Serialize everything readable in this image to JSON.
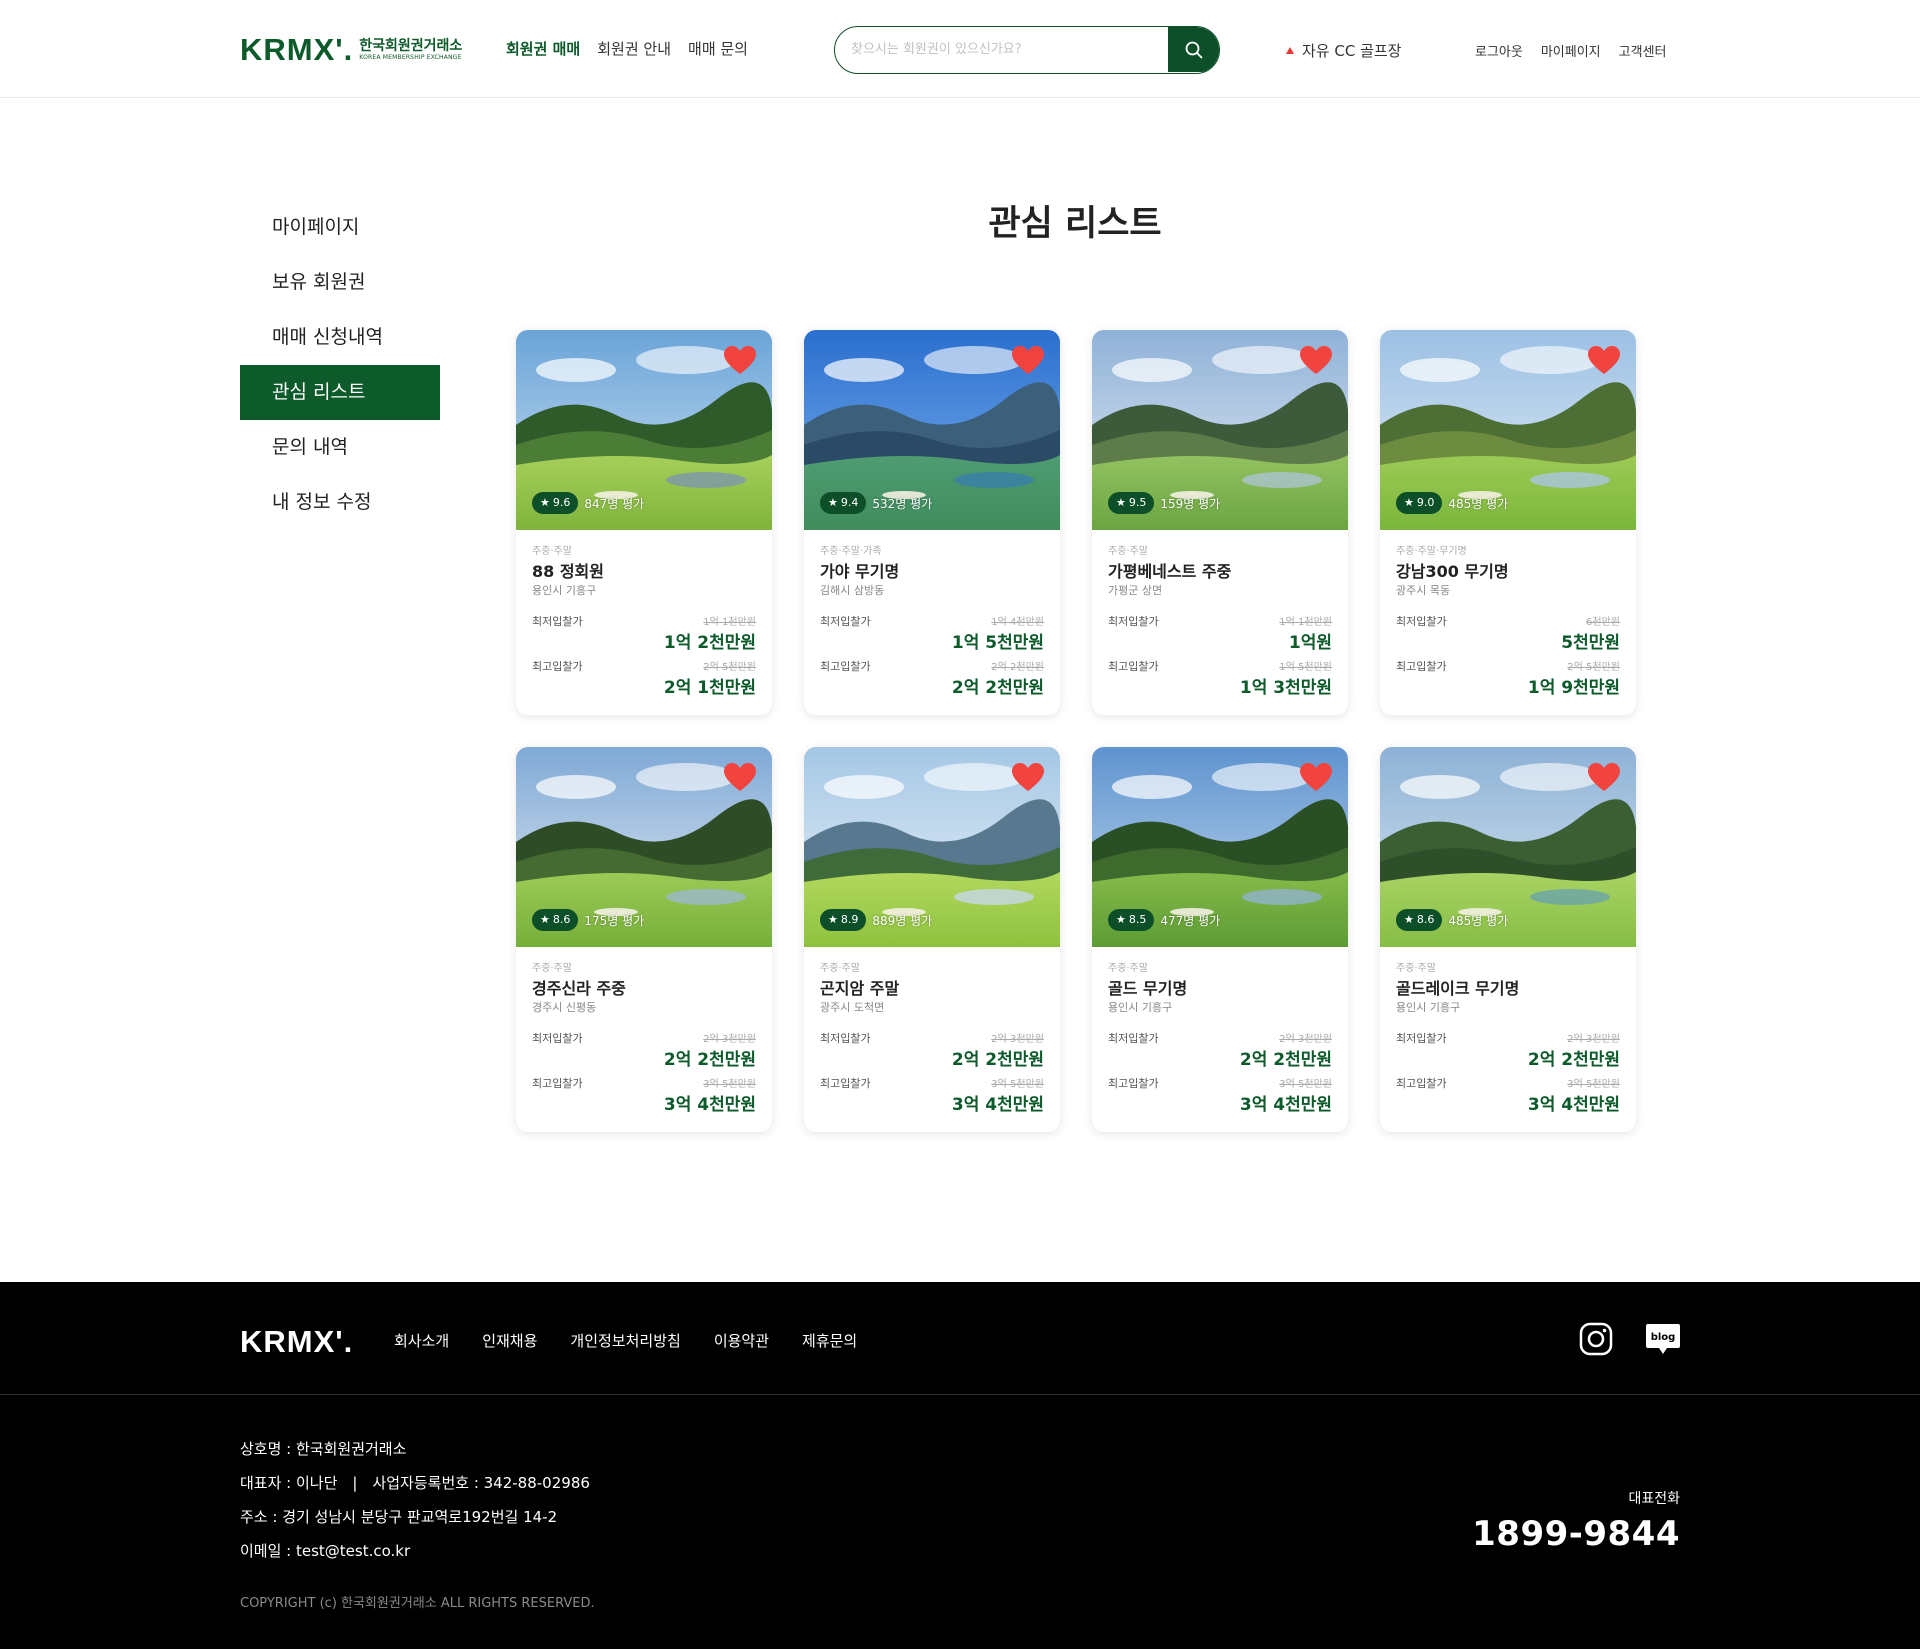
{
  "header": {
    "logo_mark": "KRMX'.",
    "logo_ko": "한국회원권거래소",
    "logo_en": "KOREA MEMBERSHIP EXCHANGE",
    "nav": [
      {
        "label": "회원권 매매",
        "active": true
      },
      {
        "label": "회원권 안내",
        "active": false
      },
      {
        "label": "매매 문의",
        "active": false
      }
    ],
    "search_placeholder": "찾으시는 회원권이 있으신가요?",
    "search_icon": "search-icon",
    "ticker": {
      "label": "자유 CC 골프장",
      "trend": "up",
      "trend_color": "#e53935"
    },
    "util_links": [
      "로그아웃",
      "마이페이지",
      "고객센터"
    ]
  },
  "sidebar": {
    "items": [
      {
        "label": "마이페이지",
        "active": false
      },
      {
        "label": "보유 회원권",
        "active": false
      },
      {
        "label": "매매 신청내역",
        "active": false
      },
      {
        "label": "관심 리스트",
        "active": true
      },
      {
        "label": "문의 내역",
        "active": false
      },
      {
        "label": "내 정보 수정",
        "active": false
      }
    ]
  },
  "main": {
    "title": "관심 리스트",
    "min_label": "최저입찰가",
    "max_label": "최고입찰가",
    "cards": [
      {
        "category": "주중·주말",
        "name": "88 정회원",
        "location": "용인시 기흥구",
        "rating": "9.6",
        "reviews": "847명 평가",
        "min_old": "1억 1천만원",
        "min_new": "1억 2천만원",
        "max_old": "2억 5천만원",
        "max_new": "2억 1천만원",
        "favorite": true
      },
      {
        "category": "주중·주말·가족",
        "name": "가야 무기명",
        "location": "김해시 삼방동",
        "rating": "9.4",
        "reviews": "532명 평가",
        "min_old": "1억 4천만원",
        "min_new": "1억 5천만원",
        "max_old": "2억 2천만원",
        "max_new": "2억 2천만원",
        "favorite": true
      },
      {
        "category": "주중·주말",
        "name": "가평베네스트 주중",
        "location": "가평군 상면",
        "rating": "9.5",
        "reviews": "159명 평가",
        "min_old": "1억 1천만원",
        "min_new": "1억원",
        "max_old": "1억 5천만원",
        "max_new": "1억 3천만원",
        "favorite": true
      },
      {
        "category": "주중·주말·무기명",
        "name": "강남300 무기명",
        "location": "광주시 목동",
        "rating": "9.0",
        "reviews": "485명 평가",
        "min_old": "6천만원",
        "min_new": "5천만원",
        "max_old": "2억 5천만원",
        "max_new": "1억 9천만원",
        "favorite": true
      },
      {
        "category": "주중·주말",
        "name": "경주신라 주중",
        "location": "경주시 신평동",
        "rating": "8.6",
        "reviews": "175명 평가",
        "min_old": "2억 3천만원",
        "min_new": "2억 2천만원",
        "max_old": "3억 5천만원",
        "max_new": "3억 4천만원",
        "favorite": true
      },
      {
        "category": "주중·주말",
        "name": "곤지암 주말",
        "location": "광주시 도척면",
        "rating": "8.9",
        "reviews": "889명 평가",
        "min_old": "2억 3천만원",
        "min_new": "2억 2천만원",
        "max_old": "3억 5천만원",
        "max_new": "3억 4천만원",
        "favorite": true
      },
      {
        "category": "주중·주말",
        "name": "골드 무기명",
        "location": "용인시 기흥구",
        "rating": "8.5",
        "reviews": "477명 평가",
        "min_old": "2억 3천만원",
        "min_new": "2억 2천만원",
        "max_old": "3억 5천만원",
        "max_new": "3억 4천만원",
        "favorite": true
      },
      {
        "category": "주중·주말",
        "name": "골드레이크 무기명",
        "location": "용인시 기흥구",
        "rating": "8.6",
        "reviews": "485명 평가",
        "min_old": "2억 3천만원",
        "min_new": "2억 2천만원",
        "max_old": "3억 5천만원",
        "max_new": "3억 4천만원",
        "favorite": true
      }
    ]
  },
  "footer": {
    "logo": "KRMX'.",
    "links": [
      "회사소개",
      "인재채용",
      "개인정보처리방침",
      "이용약관",
      "제휴문의"
    ],
    "sns": [
      "instagram-icon",
      "blog-icon"
    ],
    "blog_label": "blog",
    "company": "상호명 : 한국회원권거래소",
    "ceo": "대표자 : 이나단",
    "biz_no": "사업자등록번호 : 342-88-02986",
    "address": "주소 : 경기 성남시 분당구 판교역로192번길 14-2",
    "email": "이메일 : test@test.co.kr",
    "copyright": "COPYRIGHT (c) 한국회원권거래소 ALL RIGHTS RESERVED.",
    "tel_label": "대표전화",
    "tel": "1899-9844"
  },
  "colors": {
    "brand": "#0d5a2a",
    "brand_dark": "#0d4f28",
    "heart": "#f2443f",
    "footer_bg": "#000000"
  }
}
